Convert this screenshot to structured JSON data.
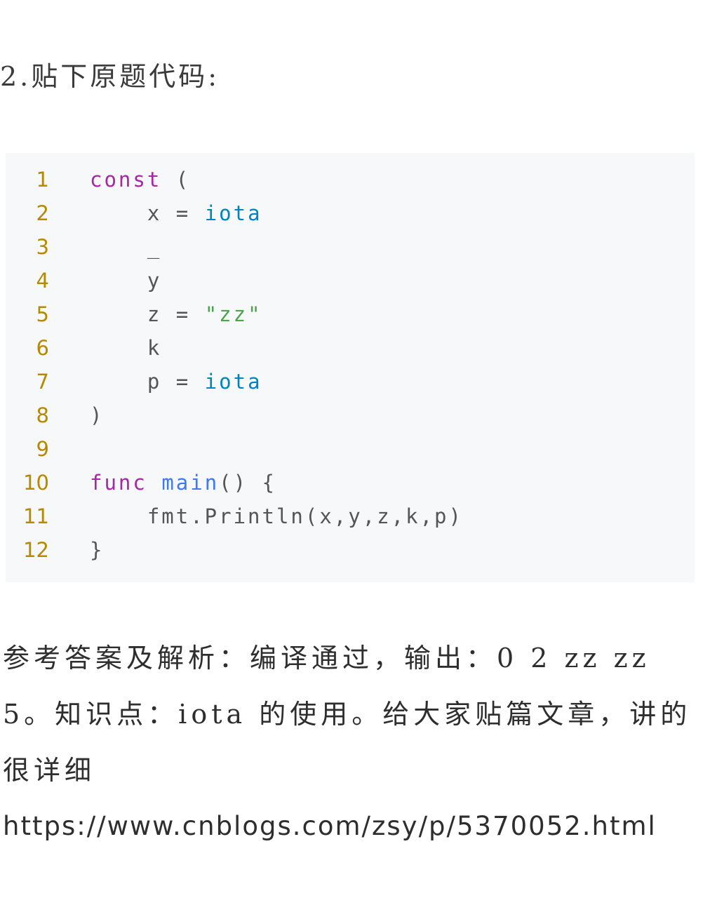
{
  "heading": "2.贴下原题代码:",
  "code_lines": [
    {
      "num": "1",
      "tokens": [
        {
          "t": "const",
          "c": "kw"
        },
        {
          "t": " (",
          "c": ""
        }
      ]
    },
    {
      "num": "2",
      "tokens": [
        {
          "t": "    x = ",
          "c": ""
        },
        {
          "t": "iota",
          "c": "builtin"
        }
      ]
    },
    {
      "num": "3",
      "tokens": [
        {
          "t": "    _",
          "c": ""
        }
      ]
    },
    {
      "num": "4",
      "tokens": [
        {
          "t": "    y",
          "c": ""
        }
      ]
    },
    {
      "num": "5",
      "tokens": [
        {
          "t": "    z = ",
          "c": ""
        },
        {
          "t": "\"zz\"",
          "c": "str"
        }
      ]
    },
    {
      "num": "6",
      "tokens": [
        {
          "t": "    k",
          "c": ""
        }
      ]
    },
    {
      "num": "7",
      "tokens": [
        {
          "t": "    p = ",
          "c": ""
        },
        {
          "t": "iota",
          "c": "builtin"
        }
      ]
    },
    {
      "num": "8",
      "tokens": [
        {
          "t": ")",
          "c": ""
        }
      ]
    },
    {
      "num": "9",
      "tokens": []
    },
    {
      "num": "10",
      "tokens": [
        {
          "t": "func",
          "c": "kw"
        },
        {
          "t": " ",
          "c": ""
        },
        {
          "t": "main",
          "c": "fn"
        },
        {
          "t": "() {",
          "c": ""
        }
      ]
    },
    {
      "num": "11",
      "tokens": [
        {
          "t": "    fmt.Println(x,y,z,k,p)",
          "c": ""
        }
      ]
    },
    {
      "num": "12",
      "tokens": [
        {
          "t": "}",
          "c": ""
        }
      ]
    }
  ],
  "answer_text": "参考答案及解析：编译通过，输出：0 2 zz zz 5。知识点：iota 的使用。给大家贴篇文章，讲的很详细",
  "link_text": "https://www.cnblogs.com/zsy/p/5370052.html"
}
